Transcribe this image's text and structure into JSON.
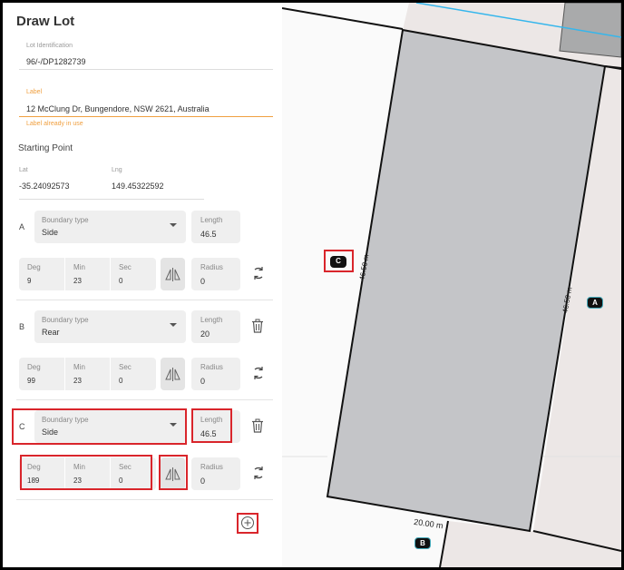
{
  "panel": {
    "title": "Draw Lot",
    "lot_id": {
      "label": "Lot Identification",
      "value": "96/-/DP1282739"
    },
    "address": {
      "label": "Label",
      "value": "12 McClung Dr, Bungendore, NSW 2621, Australia",
      "error": "Label already in use"
    },
    "starting_point": {
      "heading": "Starting Point",
      "lat_label": "Lat",
      "lat_value": "-35.24092573",
      "lng_label": "Lng",
      "lng_value": "149.45322592"
    },
    "labels": {
      "boundary_type": "Boundary type",
      "length": "Length",
      "deg": "Deg",
      "min": "Min",
      "sec": "Sec",
      "radius": "Radius"
    },
    "boundaries": [
      {
        "letter": "A",
        "type": "Side",
        "length": "46.5",
        "deg": "9",
        "min": "23",
        "sec": "0",
        "radius": "0"
      },
      {
        "letter": "B",
        "type": "Rear",
        "length": "20",
        "deg": "99",
        "min": "23",
        "sec": "0",
        "radius": "0"
      },
      {
        "letter": "C",
        "type": "Side",
        "length": "46.5",
        "deg": "189",
        "min": "23",
        "sec": "0",
        "radius": "0"
      }
    ],
    "icons": {
      "mirror": "mirror-icon",
      "rotate": "rotate-icon",
      "trash": "trash-icon",
      "add": "plus-circle-icon"
    }
  },
  "map": {
    "dimension_labels": {
      "left_side": "46.50 m",
      "right_side": "46.50 m",
      "bottom": "20.00 m"
    },
    "markers": {
      "a": "A",
      "b": "B",
      "c": "C"
    },
    "colors": {
      "lot_fill": "#c4c5c8",
      "neighbor_fill": "#ece7e6",
      "road_line": "#35b6ec",
      "highlight": "#d9252b"
    }
  }
}
